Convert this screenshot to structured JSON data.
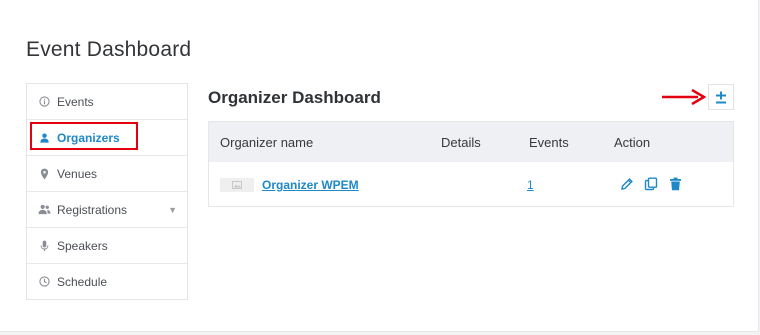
{
  "page": {
    "title": "Event Dashboard"
  },
  "sidebar": {
    "items": [
      {
        "label": "Events",
        "icon": "info-circle-icon"
      },
      {
        "label": "Organizers",
        "icon": "user-icon",
        "active": true
      },
      {
        "label": "Venues",
        "icon": "map-pin-icon"
      },
      {
        "label": "Registrations",
        "icon": "users-icon",
        "has_dropdown": true
      },
      {
        "label": "Speakers",
        "icon": "microphone-icon"
      },
      {
        "label": "Schedule",
        "icon": "clock-icon"
      }
    ]
  },
  "main": {
    "title": "Organizer Dashboard",
    "add_button_icon": "plus-minus-icon",
    "table": {
      "headers": [
        "Organizer name",
        "Details",
        "Events",
        "Action"
      ],
      "rows": [
        {
          "name": "Organizer WPEM",
          "details": "",
          "events": "1",
          "actions": [
            "edit-icon",
            "duplicate-icon",
            "trash-icon"
          ]
        }
      ]
    }
  },
  "colors": {
    "accent": "#1e88c9",
    "highlight": "#e3000f",
    "header_bg": "#eff0f3"
  }
}
